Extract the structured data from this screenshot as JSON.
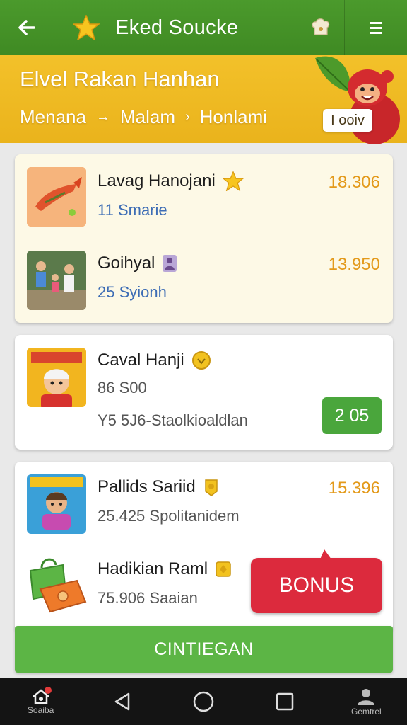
{
  "topbar": {
    "title": "Eked Soucke",
    "back_icon": "back-arrow-icon",
    "star_icon": "star-icon",
    "chef_icon": "chef-hat-icon",
    "menu_icon": "menu-icon"
  },
  "banner": {
    "title": "Elvel Rakan Hanhan",
    "breadcrumbs": [
      "Menana",
      "Malam",
      "Honlami"
    ],
    "separators": [
      "→",
      "›"
    ],
    "chip": "I ooiv"
  },
  "cards": [
    {
      "items": [
        {
          "name": "Lavag Hanojani",
          "sub": "11 Smarie",
          "price": "18.306",
          "badge_icon": "star-icon"
        },
        {
          "name": "Goihyal",
          "sub": "25 Syionh",
          "price": "13.950",
          "badge_icon": "person-icon"
        }
      ]
    },
    {
      "items": [
        {
          "name": "Caval Hanji",
          "sub": "86 S00",
          "sub2": "Y5 5J6-Staolkioaldlan",
          "button": "2 05",
          "badge_icon": "coin-icon"
        }
      ]
    },
    {
      "items": [
        {
          "name": "Pallids Sariid",
          "sub": "25.425 Spolitanidem",
          "price": "15.396",
          "badge_icon": "coin-icon"
        },
        {
          "name": "Hadikian Raml",
          "sub": "75.906 Saaian",
          "badge_icon": "coin-icon"
        }
      ]
    }
  ],
  "bonus_label": "BONUS",
  "cta_label": "CINTIEGAN",
  "navbar": {
    "home_label": "Soaiba",
    "profile_label": "Gemtrel"
  },
  "colors": {
    "green": "#4b9a2c",
    "yellow": "#f3c12a",
    "price": "#e39a1b",
    "bonus": "#dc2a3d",
    "cta": "#5cb545"
  }
}
